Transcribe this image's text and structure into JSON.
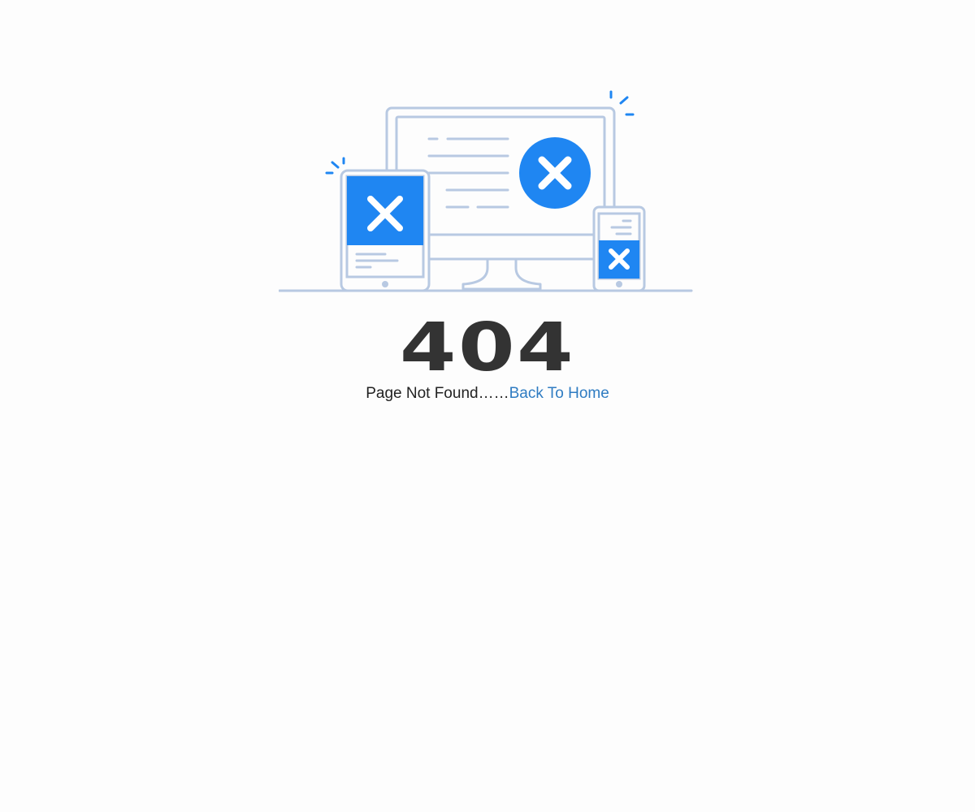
{
  "error": {
    "code": "404",
    "message": "Page Not Found……",
    "home_link": "Back To Home"
  },
  "illustration": {
    "icons": [
      "monitor-icon",
      "tablet-icon",
      "phone-icon",
      "error-x-icon"
    ],
    "colors": {
      "outline": "#b8c9e2",
      "accent": "#1f86f2",
      "spark": "#1f86f2"
    }
  },
  "colors": {
    "background": "#fdfdfd",
    "code_text": "#333333",
    "message_text": "#222222",
    "link": "#2f7cc2"
  }
}
